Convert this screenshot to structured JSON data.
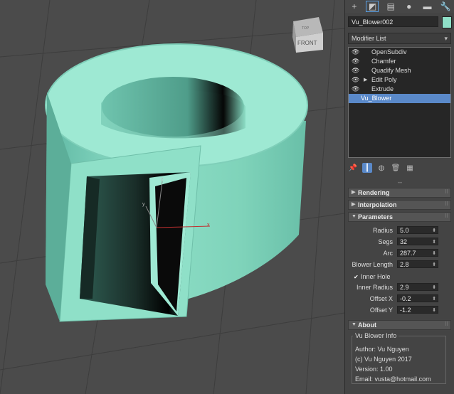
{
  "viewport": {
    "viewcube_top": "TOP",
    "viewcube_front": "FRONT",
    "gizmo_axes": [
      "x",
      "y",
      "z"
    ]
  },
  "command_panel": {
    "tabs": [
      {
        "icon": "create-icon",
        "glyph": "+"
      },
      {
        "icon": "modify-icon",
        "glyph": "◩"
      },
      {
        "icon": "hierarchy-icon",
        "glyph": "▤"
      },
      {
        "icon": "motion-icon",
        "glyph": "●"
      },
      {
        "icon": "display-icon",
        "glyph": "▬"
      },
      {
        "icon": "utilities-icon",
        "glyph": "🔧"
      }
    ],
    "object_name": "Vu_Blower002",
    "object_color": "#8fe0c8",
    "modifier_list_label": "Modifier List",
    "stack": [
      {
        "label": "OpenSubdiv",
        "eye": true,
        "expand": false
      },
      {
        "label": "Chamfer",
        "eye": true,
        "expand": false
      },
      {
        "label": "Quadify Mesh",
        "eye": true,
        "expand": false
      },
      {
        "label": "Edit Poly",
        "eye": true,
        "expand": true
      },
      {
        "label": "Extrude",
        "eye": true,
        "expand": false
      },
      {
        "label": "Vu_Blower",
        "eye": false,
        "expand": false,
        "selected": true
      }
    ],
    "stack_tools": [
      "pin-stack-icon",
      "show-end-result-icon",
      "make-unique-icon",
      "remove-modifier-icon",
      "configure-sets-icon"
    ],
    "rollouts": {
      "rendering": "Rendering",
      "interpolation": "Interpolation",
      "parameters": "Parameters",
      "about": "About"
    },
    "parameters": {
      "radius_label": "Radius",
      "radius_value": "5.0",
      "segs_label": "Segs",
      "segs_value": "32",
      "arc_label": "Arc",
      "arc_value": "287.7",
      "blower_length_label": "Blower Length",
      "blower_length_value": "2.8",
      "inner_hole_label": "Inner Hole",
      "inner_hole_checked": true,
      "inner_radius_label": "Inner Radius",
      "inner_radius_value": "2.9",
      "offset_x_label": "Offset X",
      "offset_x_value": "-0.2",
      "offset_y_label": "Offset Y",
      "offset_y_value": "-1.2"
    },
    "about": {
      "group_title": "Vu Blower Info",
      "author": "Author: Vu Nguyen",
      "copyright": "(c) Vu Nguyen 2017",
      "version": "Version: 1.00",
      "email": "Email: vusta@hotmail.com"
    }
  }
}
